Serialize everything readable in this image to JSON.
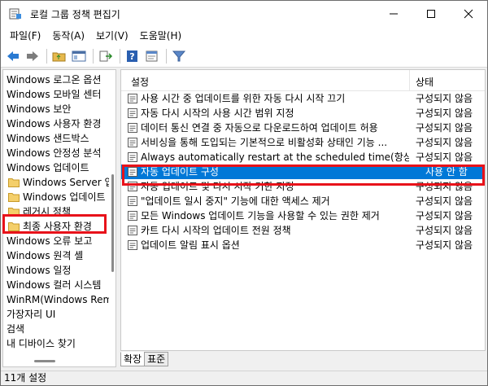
{
  "window": {
    "title": "로컬 그룹 정책 편집기",
    "accent": "#0078d7",
    "highlight_color": "#e8121a"
  },
  "menu": {
    "items": [
      "파일(F)",
      "동작(A)",
      "보기(V)",
      "도움말(H)"
    ]
  },
  "tree": {
    "items": [
      {
        "label": "Windows 로그온 옵션",
        "folder": false
      },
      {
        "label": "Windows 모바일 센터",
        "folder": false
      },
      {
        "label": "Windows 보안",
        "folder": false
      },
      {
        "label": "Windows 사용자 환경",
        "folder": false
      },
      {
        "label": "Windows 샌드박스",
        "folder": false
      },
      {
        "label": "Windows 안정성 분석",
        "folder": false
      },
      {
        "label": "Windows 업데이트",
        "folder": false
      },
      {
        "label": "Windows Server 업",
        "folder": true
      },
      {
        "label": "Windows 업데이트",
        "folder": true
      },
      {
        "label": "레거시 정책",
        "folder": true
      },
      {
        "label": "최종 사용자 환경",
        "folder": true
      },
      {
        "label": "Windows 오류 보고",
        "folder": false
      },
      {
        "label": "Windows 원격 셸",
        "folder": false
      },
      {
        "label": "Windows 일정",
        "folder": false
      },
      {
        "label": "Windows 컬러 시스템",
        "folder": false
      },
      {
        "label": "WinRM(Windows Rem",
        "folder": false
      },
      {
        "label": "가장자리 UI",
        "folder": false
      },
      {
        "label": "검색",
        "folder": false
      },
      {
        "label": "내 디바이스 찾기",
        "folder": false
      }
    ]
  },
  "list": {
    "col_setting": "설정",
    "col_state": "상태",
    "rows": [
      {
        "name": "사용 시간 중 업데이트를 위한 자동 다시 시작 끄기",
        "state": "구성되지 않음"
      },
      {
        "name": "자동 다시 시작의 사용 시간 범위 지정",
        "state": "구성되지 않음"
      },
      {
        "name": "데이터 통신 연결 중 자동으로 다운로드하여 업데이트 허용",
        "state": "구성되지 않음"
      },
      {
        "name": "서비싱을 통해 도입되는 기본적으로 비활성화 상태인 기능 ...",
        "state": "구성되지 않음"
      },
      {
        "name": "Always automatically restart at the scheduled time(항상 예...",
        "state": "구성되지 않음"
      },
      {
        "name": "자동 업데이트 구성",
        "state": "사용 안 함"
      },
      {
        "name": "자동 업데이트 및 다시 시작 기한 지정",
        "state": "구성되지 않음"
      },
      {
        "name": "\"업데이트 일시 중지\" 기능에 대한 액세스 제거",
        "state": "구성되지 않음"
      },
      {
        "name": "모든 Windows 업데이트 기능을 사용할 수 있는 권한 제거",
        "state": "구성되지 않음"
      },
      {
        "name": "카트 다시 시작의 업데이트 전원 정책",
        "state": "구성되지 않음"
      },
      {
        "name": "업데이트 알림 표시 옵션",
        "state": "구성되지 않음"
      }
    ]
  },
  "tabs": [
    "확장",
    "표준"
  ],
  "status": {
    "text": "11개 설정"
  }
}
